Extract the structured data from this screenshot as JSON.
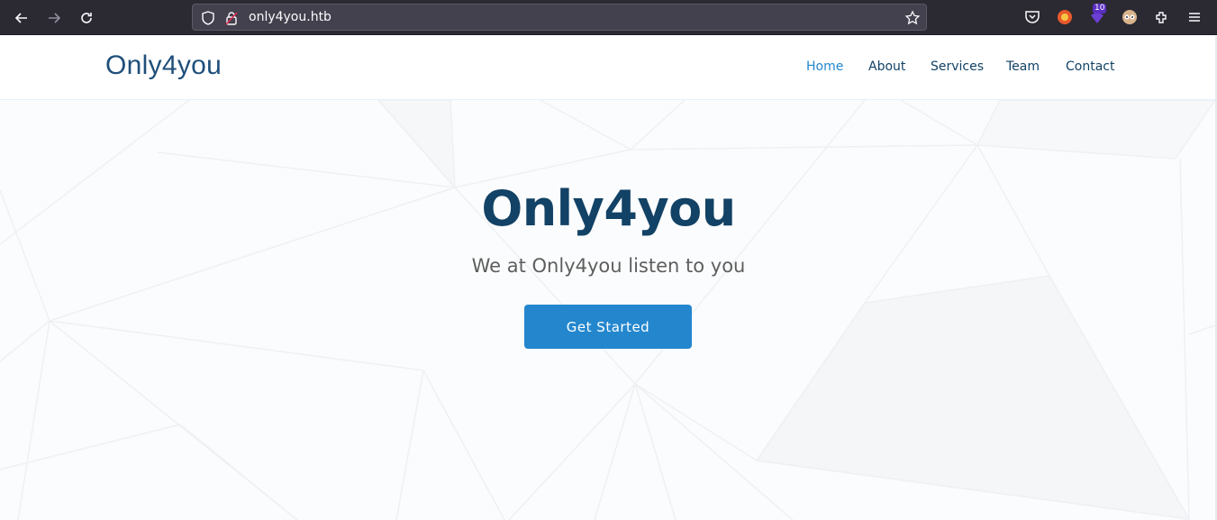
{
  "browser": {
    "url": "only4you.htb",
    "extension_badge": "10",
    "icons": [
      "back-icon",
      "forward-icon",
      "reload-icon",
      "shield-icon",
      "lock-icon",
      "star-icon",
      "pocket-icon",
      "extension-icon",
      "extensions-icon",
      "menu-icon"
    ]
  },
  "site": {
    "logo": "Only4you",
    "nav": [
      {
        "label": "Home",
        "active": true
      },
      {
        "label": "About",
        "active": false
      },
      {
        "label": "Services",
        "active": false
      },
      {
        "label": "Team",
        "active": false
      },
      {
        "label": "Contact",
        "active": false
      }
    ]
  },
  "hero": {
    "title": "Only4you",
    "subtitle": "We at Only4you listen to you",
    "cta_label": "Get Started"
  },
  "colors": {
    "accent": "#2487ce",
    "heading": "#124265",
    "chrome_bg": "#2b2a33"
  }
}
